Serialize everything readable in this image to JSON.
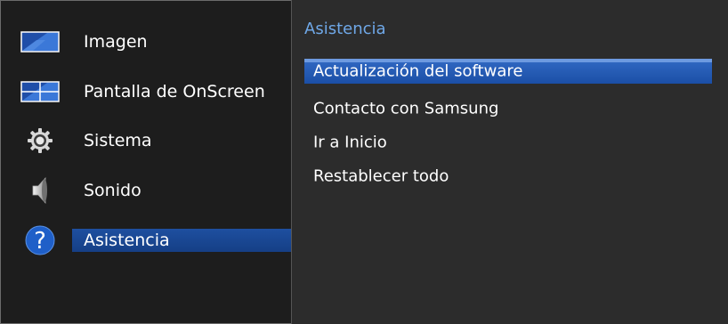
{
  "menu": {
    "items": [
      {
        "label": "Imagen",
        "icon": "picture-icon"
      },
      {
        "label": "Pantalla de OnScreen",
        "icon": "onscreen-display-icon"
      },
      {
        "label": "Sistema",
        "icon": "gear-icon"
      },
      {
        "label": "Sonido",
        "icon": "speaker-icon"
      },
      {
        "label": "Asistencia",
        "icon": "help-icon",
        "selected": true
      }
    ]
  },
  "submenu": {
    "title": "Asistencia",
    "items": [
      {
        "label": "Actualización del software",
        "selected": true
      },
      {
        "label": "Contacto con Samsung"
      },
      {
        "label": "Ir a Inicio"
      },
      {
        "label": "Restablecer todo"
      }
    ]
  },
  "colors": {
    "panel_bg": "#1d1d1d",
    "submenu_bg": "#2c2c2c",
    "highlight": "#1e4fa0",
    "title_accent": "#6fa8e8"
  },
  "help_glyph": "?"
}
